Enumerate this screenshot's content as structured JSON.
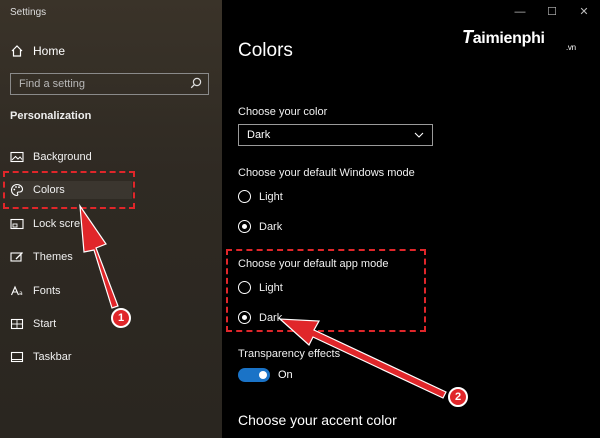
{
  "window": {
    "title": "Settings",
    "controls": [
      "—",
      "☐",
      "✕"
    ]
  },
  "sidebar": {
    "home_label": "Home",
    "search_placeholder": "Find a setting",
    "section": "Personalization",
    "items": [
      {
        "label": "Background",
        "icon": "image-icon"
      },
      {
        "label": "Colors",
        "icon": "palette-icon",
        "active": true
      },
      {
        "label": "Lock scre",
        "icon": "lock-screen-icon"
      },
      {
        "label": "Themes",
        "icon": "themes-icon"
      },
      {
        "label": "Fonts",
        "icon": "fonts-icon"
      },
      {
        "label": "Start",
        "icon": "start-icon"
      },
      {
        "label": "Taskbar",
        "icon": "taskbar-icon"
      }
    ]
  },
  "main": {
    "title": "Colors",
    "logo": {
      "brand": "aimienphi",
      "brand_initial": "T",
      "tld": ".vn"
    },
    "choose_color": {
      "label": "Choose your color",
      "value": "Dark"
    },
    "windows_mode": {
      "label": "Choose your default Windows mode",
      "options": [
        "Light",
        "Dark"
      ],
      "selected": "Dark"
    },
    "app_mode": {
      "label": "Choose your default app mode",
      "options": [
        "Light",
        "Dark"
      ],
      "selected": "Dark"
    },
    "transparency": {
      "label": "Transparency effects",
      "state": "On"
    },
    "accent_heading": "Choose your accent color"
  },
  "annotations": {
    "badge1": "1",
    "badge2": "2",
    "highlight_color": "#e0262a"
  }
}
